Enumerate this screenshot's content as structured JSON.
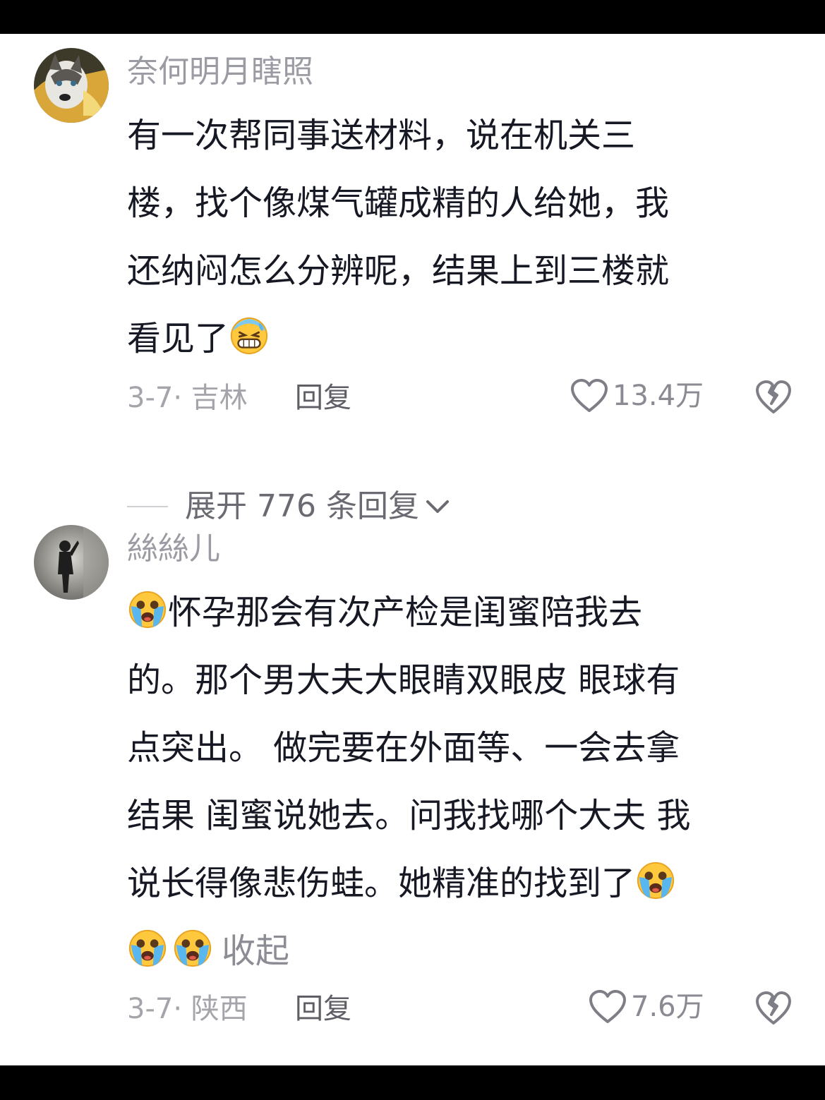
{
  "comments": [
    {
      "username": "奈何明月瞎照",
      "lines": [
        "有一次帮同事送材料，说在机关三",
        "楼，找个像煤气罐成精的人给她，我",
        "还纳闷怎么分辨呢，结果上到三楼就",
        "看见了"
      ],
      "emoji": "grinning-sweat-emoji",
      "date_location": "3-7· 吉林",
      "reply_label": "回复",
      "likes": "13.4万"
    },
    {
      "username": "絲絲儿",
      "lines": [
        "怀孕那会有次产检是闺蜜陪我去",
        "的。那个男大夫大眼睛双眼皮 眼球有",
        "点突出。 做完要在外面等、一会去拿",
        "结果 闺蜜说她去。问我找哪个大夫 我",
        "说长得像悲伤蛙。她精准的找到了"
      ],
      "emoji": "loudly-crying-emoji",
      "collapse_label": "收起",
      "date_location": "3-7· 陕西",
      "reply_label": "回复",
      "likes": "7.6万"
    }
  ],
  "expand_replies": "展开 776 条回复",
  "colors": {
    "text": "#161823",
    "secondary": "#9b9ba3",
    "background": "#ffffff",
    "frame": "#000000"
  }
}
